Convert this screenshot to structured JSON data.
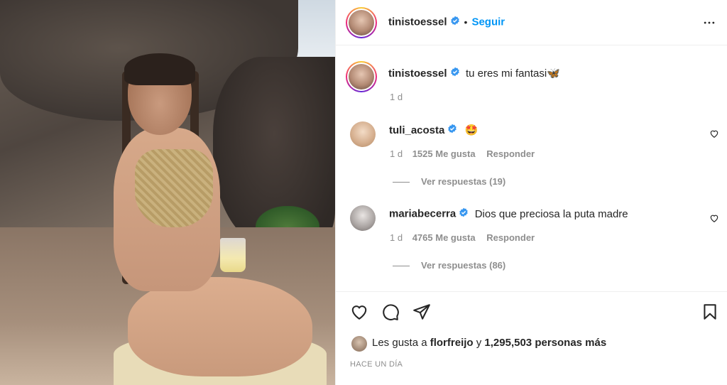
{
  "post": {
    "author": "tinistoessel",
    "follow_label": "Seguir",
    "dot": "•",
    "caption": "tu eres mi fantasi🦋",
    "caption_time": "1 d"
  },
  "comments": [
    {
      "user": "tuli_acosta",
      "text": "🤩",
      "time": "1 d",
      "likes": "1525 Me gusta",
      "reply": "Responder",
      "view_replies": "Ver respuestas (19)"
    },
    {
      "user": "mariabecerra",
      "text": "Dios que preciosa la puta madre",
      "time": "1 d",
      "likes": "4765 Me gusta",
      "reply": "Responder",
      "view_replies": "Ver respuestas (86)"
    }
  ],
  "likes": {
    "prefix": "Les gusta a",
    "user": "florfreijo",
    "middle": "y",
    "count": "1,295,503 personas más"
  },
  "timeago": "HACE UN DÍA",
  "colors": {
    "accent": "#0095f6",
    "verified": "#3897f0",
    "text": "#262626",
    "muted": "#8e8e8e",
    "border": "#efefef"
  },
  "icons": [
    "more-icon",
    "verified-badge-icon",
    "heart-icon",
    "comment-icon",
    "share-icon",
    "bookmark-icon"
  ]
}
